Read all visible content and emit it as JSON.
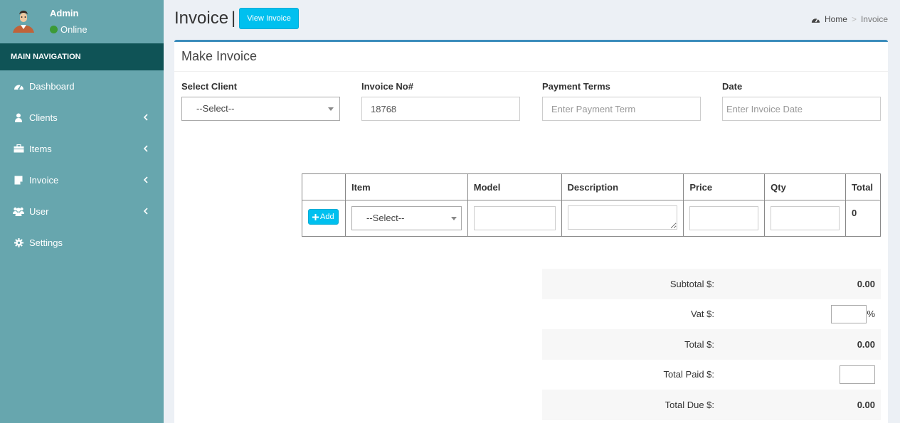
{
  "sidebar": {
    "user_name": "Admin",
    "user_status": "Online",
    "nav_header": "MAIN NAVIGATION",
    "items": [
      {
        "label": "Dashboard",
        "icon": "dashboard-icon",
        "has_chevron": false
      },
      {
        "label": "Clients",
        "icon": "user-icon",
        "has_chevron": true
      },
      {
        "label": "Items",
        "icon": "briefcase-icon",
        "has_chevron": true
      },
      {
        "label": "Invoice",
        "icon": "document-icon",
        "has_chevron": true
      },
      {
        "label": "User",
        "icon": "users-icon",
        "has_chevron": true
      },
      {
        "label": "Settings",
        "icon": "gear-icon",
        "has_chevron": false
      }
    ]
  },
  "header": {
    "title": "Invoice",
    "separator": "|",
    "view_button": "View Invoice",
    "breadcrumb": {
      "home": "Home",
      "separator": ">",
      "current": "Invoice"
    }
  },
  "box": {
    "title": "Make Invoice"
  },
  "form": {
    "client": {
      "label": "Select Client",
      "value": "--Select--"
    },
    "invoice_no": {
      "label": "Invoice No#",
      "value": "18768"
    },
    "payment_terms": {
      "label": "Payment Terms",
      "placeholder": "Enter Payment Term"
    },
    "date": {
      "label": "Date",
      "placeholder": "Enter Invoice Date"
    }
  },
  "table": {
    "headers": [
      "",
      "Item",
      "Model",
      "Description",
      "Price",
      "Qty",
      "Total"
    ],
    "add_button": "Add",
    "item_select": "--Select--",
    "row_total": "0"
  },
  "summary": {
    "subtotal_label": "Subtotal $:",
    "subtotal_value": "0.00",
    "vat_label": "Vat $:",
    "vat_unit": "%",
    "total_label": "Total $:",
    "total_value": "0.00",
    "paid_label": "Total Paid $:",
    "due_label": "Total Due $:",
    "due_value": "0.00"
  },
  "colors": {
    "sidebar_bg": "#67a6ae",
    "nav_header_bg": "#0f5356",
    "accent": "#00c0ef",
    "box_top": "#3c8dbc"
  }
}
